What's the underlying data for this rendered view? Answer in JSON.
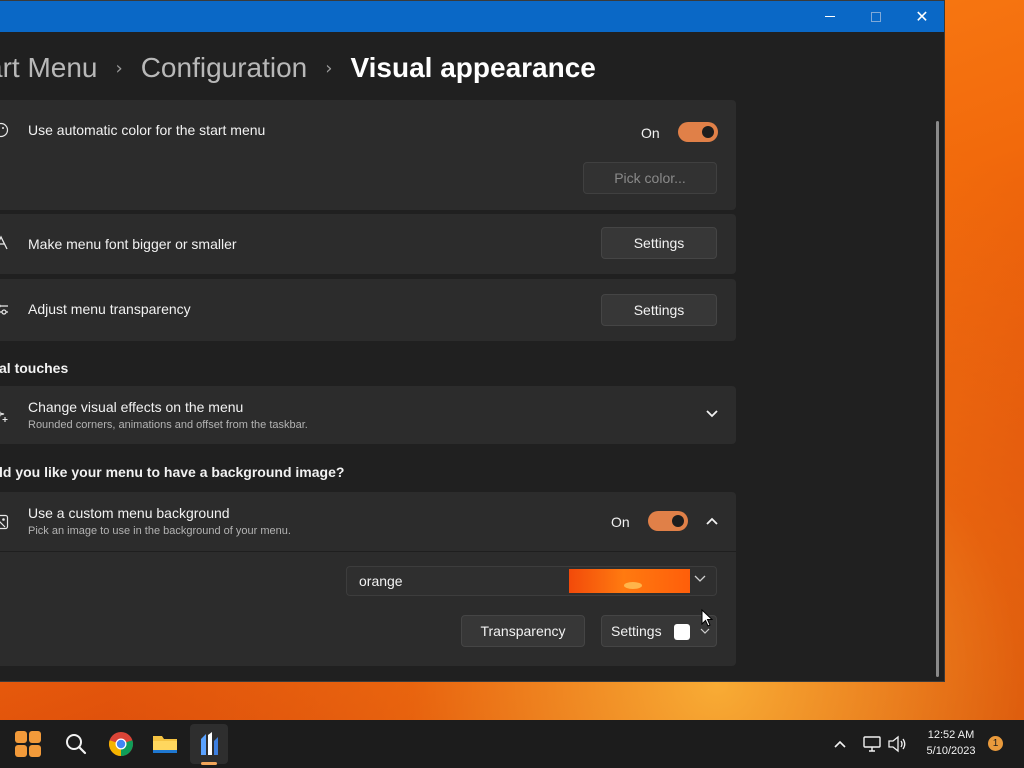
{
  "window": {
    "title": "",
    "controls": {
      "minimize_icon": "minimize-icon",
      "maximize_icon": "maximize-icon",
      "close_glyph": "✕"
    }
  },
  "breadcrumb": {
    "items": [
      "art Menu",
      "Configuration"
    ],
    "current": "Visual appearance",
    "separator": "›"
  },
  "settings": {
    "auto_color": {
      "title": "Use automatic color for the start menu",
      "toggle_label": "On",
      "toggle_on": true,
      "pick_color_button": "Pick color..."
    },
    "font_size": {
      "title": "Make menu font bigger or smaller",
      "button": "Settings"
    },
    "transparency": {
      "title": "Adjust menu transparency",
      "button": "Settings"
    },
    "visual_touches_section": "al touches",
    "visual_effects": {
      "title": "Change visual effects on the menu",
      "subtitle": "Rounded corners, animations and offset from the taskbar."
    },
    "background_section": "ld you like your menu to have a background image?",
    "custom_background": {
      "title": "Use a custom menu background",
      "subtitle": "Pick an image to use in the background of your menu.",
      "toggle_label": "On",
      "toggle_on": true,
      "dropdown_value": "orange",
      "transparency_button": "Transparency",
      "settings_button": "Settings"
    }
  },
  "taskbar": {
    "icons": [
      "start-icon",
      "search-icon",
      "chrome-icon",
      "file-explorer-icon",
      "app-icon"
    ],
    "tray": {
      "time": "12:52 AM",
      "date": "5/10/2023",
      "notification_count": "1"
    }
  },
  "colors": {
    "accent": "#e08048",
    "titlebar": "#0a68c6",
    "window_bg": "#202020",
    "card_bg": "#2c2c2c"
  }
}
